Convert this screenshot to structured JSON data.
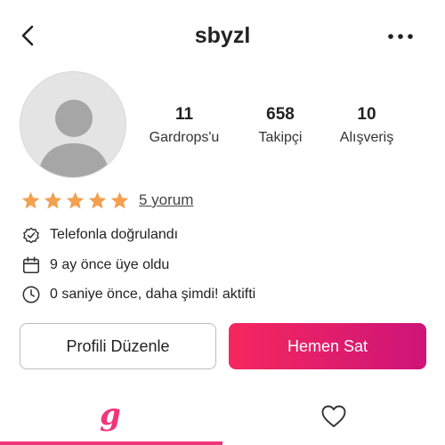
{
  "header": {
    "title": "sbyzl"
  },
  "stats": [
    {
      "value": "11",
      "label": "Gardrops'u"
    },
    {
      "value": "658",
      "label": "Takipçi"
    },
    {
      "value": "10",
      "label": "Alışveriş"
    }
  ],
  "rating": {
    "stars": 5,
    "max": 5,
    "reviews": "5 yorum",
    "star_color": "#f3a04f"
  },
  "info": {
    "phone": "Telefonla doğrulandı",
    "member": "9 ay önce üye oldu",
    "active": "0 saniye önce, daha şimdi! aktifti"
  },
  "actions": {
    "edit": "Profili Düzenle",
    "sell": "Hemen Sat"
  },
  "tabs": {
    "closet_glyph": "g"
  },
  "colors": {
    "accent": "#f2357a",
    "sell_start": "#f5275e",
    "sell_end": "#ce1478"
  }
}
